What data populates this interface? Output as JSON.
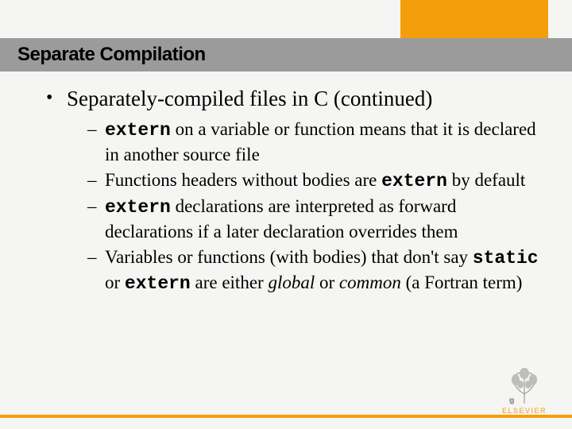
{
  "title": "Separate Compilation",
  "bullet": {
    "text": "Separately-compiled files in C (continued)",
    "subs": [
      {
        "parts": [
          {
            "t": "extern",
            "cls": "kw"
          },
          {
            "t": " on a variable or function means that it is declared in another source file"
          }
        ]
      },
      {
        "parts": [
          {
            "t": "Functions headers without bodies are "
          },
          {
            "t": "extern",
            "cls": "kw"
          },
          {
            "t": " by default"
          }
        ]
      },
      {
        "parts": [
          {
            "t": "extern",
            "cls": "kw"
          },
          {
            "t": " declarations are interpreted as forward declarations if a later declaration overrides them"
          }
        ]
      },
      {
        "parts": [
          {
            "t": "Variables or functions (with bodies) that don't say "
          },
          {
            "t": "static",
            "cls": "kw"
          },
          {
            "t": " or "
          },
          {
            "t": "extern",
            "cls": "kw"
          },
          {
            "t": " are either "
          },
          {
            "t": "global",
            "cls": "ital"
          },
          {
            "t": " or "
          },
          {
            "t": "common",
            "cls": "ital"
          },
          {
            "t": " (a Fortran term)"
          }
        ]
      }
    ]
  },
  "logo_text": "ELSEVIER"
}
